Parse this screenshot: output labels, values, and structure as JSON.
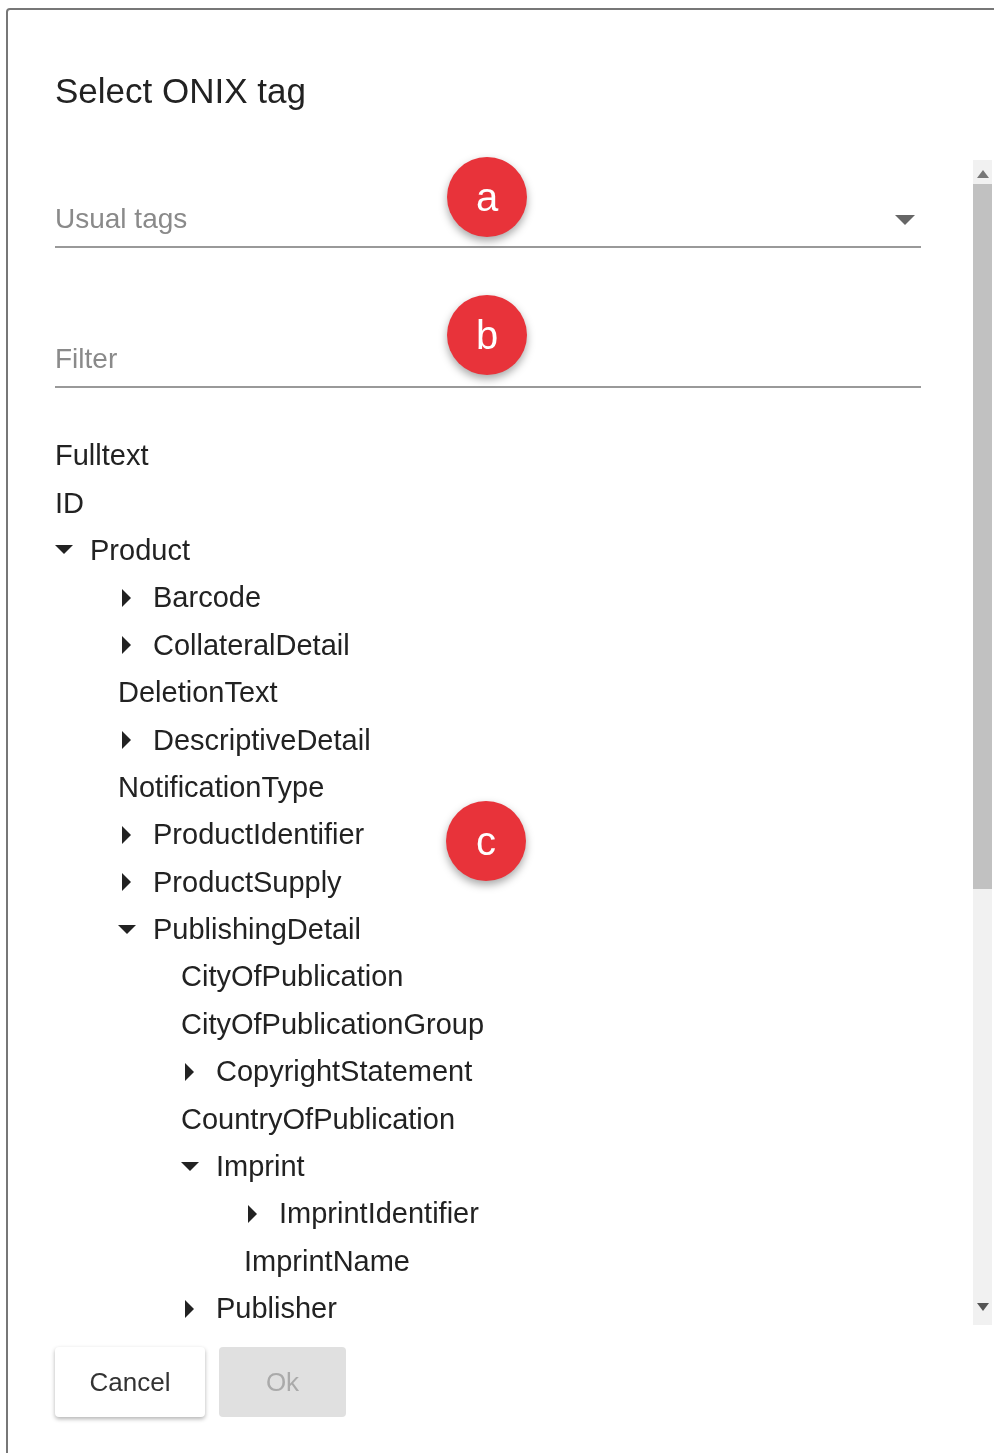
{
  "dialog": {
    "title": "Select ONIX tag"
  },
  "usual_tags": {
    "placeholder": "Usual tags"
  },
  "filter": {
    "placeholder": "Filter"
  },
  "tree": [
    {
      "label": "Fulltext",
      "kind": "leaf"
    },
    {
      "label": "ID",
      "kind": "leaf"
    },
    {
      "label": "Product",
      "kind": "branch",
      "expanded": true,
      "children": [
        {
          "label": "Barcode",
          "kind": "branch",
          "expanded": false
        },
        {
          "label": "CollateralDetail",
          "kind": "branch",
          "expanded": false
        },
        {
          "label": "DeletionText",
          "kind": "leaf"
        },
        {
          "label": "DescriptiveDetail",
          "kind": "branch",
          "expanded": false
        },
        {
          "label": "NotificationType",
          "kind": "leaf"
        },
        {
          "label": "ProductIdentifier",
          "kind": "branch",
          "expanded": false
        },
        {
          "label": "ProductSupply",
          "kind": "branch",
          "expanded": false
        },
        {
          "label": "PublishingDetail",
          "kind": "branch",
          "expanded": true,
          "children": [
            {
              "label": "CityOfPublication",
              "kind": "leaf"
            },
            {
              "label": "CityOfPublicationGroup",
              "kind": "leaf"
            },
            {
              "label": "CopyrightStatement",
              "kind": "branch",
              "expanded": false
            },
            {
              "label": "CountryOfPublication",
              "kind": "leaf"
            },
            {
              "label": "Imprint",
              "kind": "branch",
              "expanded": true,
              "children": [
                {
                  "label": "ImprintIdentifier",
                  "kind": "branch",
                  "expanded": false
                },
                {
                  "label": "ImprintName",
                  "kind": "leaf"
                }
              ]
            },
            {
              "label": "Publisher",
              "kind": "branch",
              "expanded": false
            }
          ]
        }
      ]
    }
  ],
  "callouts": [
    {
      "label": "a"
    },
    {
      "label": "b"
    },
    {
      "label": "c"
    }
  ],
  "buttons": [
    {
      "label": "Cancel",
      "disabled": false
    },
    {
      "label": "Ok",
      "disabled": true
    }
  ]
}
